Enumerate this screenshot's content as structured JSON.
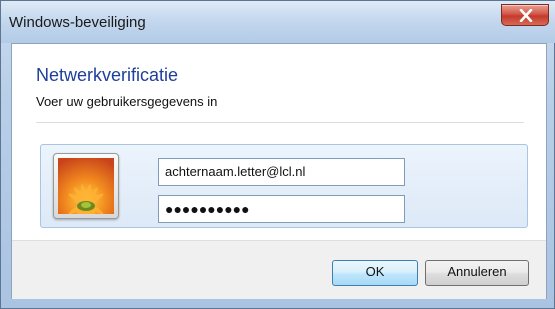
{
  "window": {
    "title": "Windows-beveiliging",
    "close_icon": "close-icon"
  },
  "dialog": {
    "heading": "Netwerkverificatie",
    "subheading": "Voer uw gebruikersgegevens in"
  },
  "credentials": {
    "avatar_icon": "user-avatar-flower",
    "username": "achternaam.letter@lcl.nl",
    "password_masked": "●●●●●●●●●●"
  },
  "buttons": {
    "ok": "OK",
    "cancel": "Annuleren"
  },
  "colors": {
    "heading": "#1e3f9a",
    "close_button": "#c43a2c",
    "ok_border": "#3c7fb1"
  }
}
